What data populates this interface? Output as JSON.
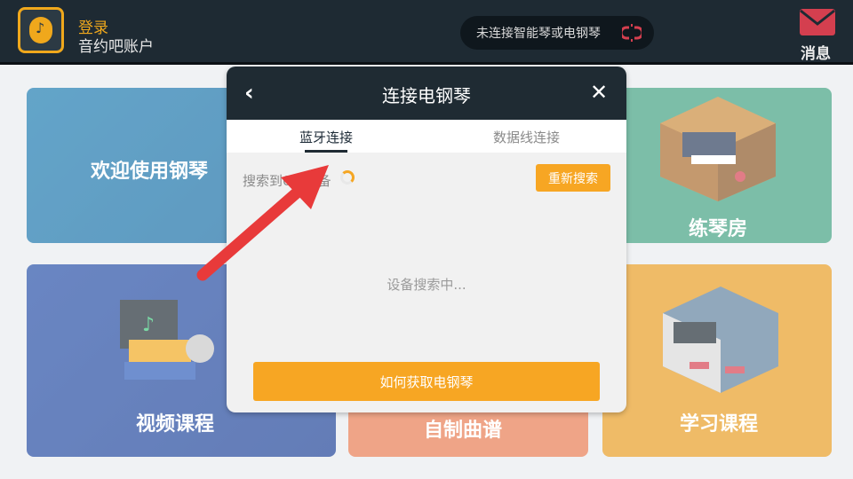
{
  "header": {
    "login_title": "登录",
    "login_subtitle": "音约吧账户",
    "connection_status": "未连接智能琴或电钢琴",
    "messages_label": "消息"
  },
  "cards": {
    "welcome": "欢迎使用钢琴",
    "practice_room": "练琴房",
    "video_courses": "视频课程",
    "custom_score": "自制曲谱",
    "learning_courses": "学习课程"
  },
  "modal": {
    "title": "连接电钢琴",
    "tabs": [
      {
        "label": "蓝牙连接",
        "active": true
      },
      {
        "label": "数据线连接",
        "active": false
      }
    ],
    "found_text": "搜索到0个设备",
    "research_button": "重新搜索",
    "searching_text": "设备搜索中...",
    "how_to_button": "如何获取电钢琴"
  },
  "icons": {
    "avatar": "app-logo-icon",
    "connection": "disconnected-link-icon",
    "messages": "envelope-icon",
    "back": "chevron-left-icon",
    "close": "close-icon",
    "spinner": "loading-spinner-icon",
    "annotation": "red-arrow-icon"
  },
  "colors": {
    "accent": "#f7a623",
    "header_bg": "#1f2b33",
    "annotation_arrow": "#e83a3a",
    "disconnected": "#d43f4f"
  }
}
